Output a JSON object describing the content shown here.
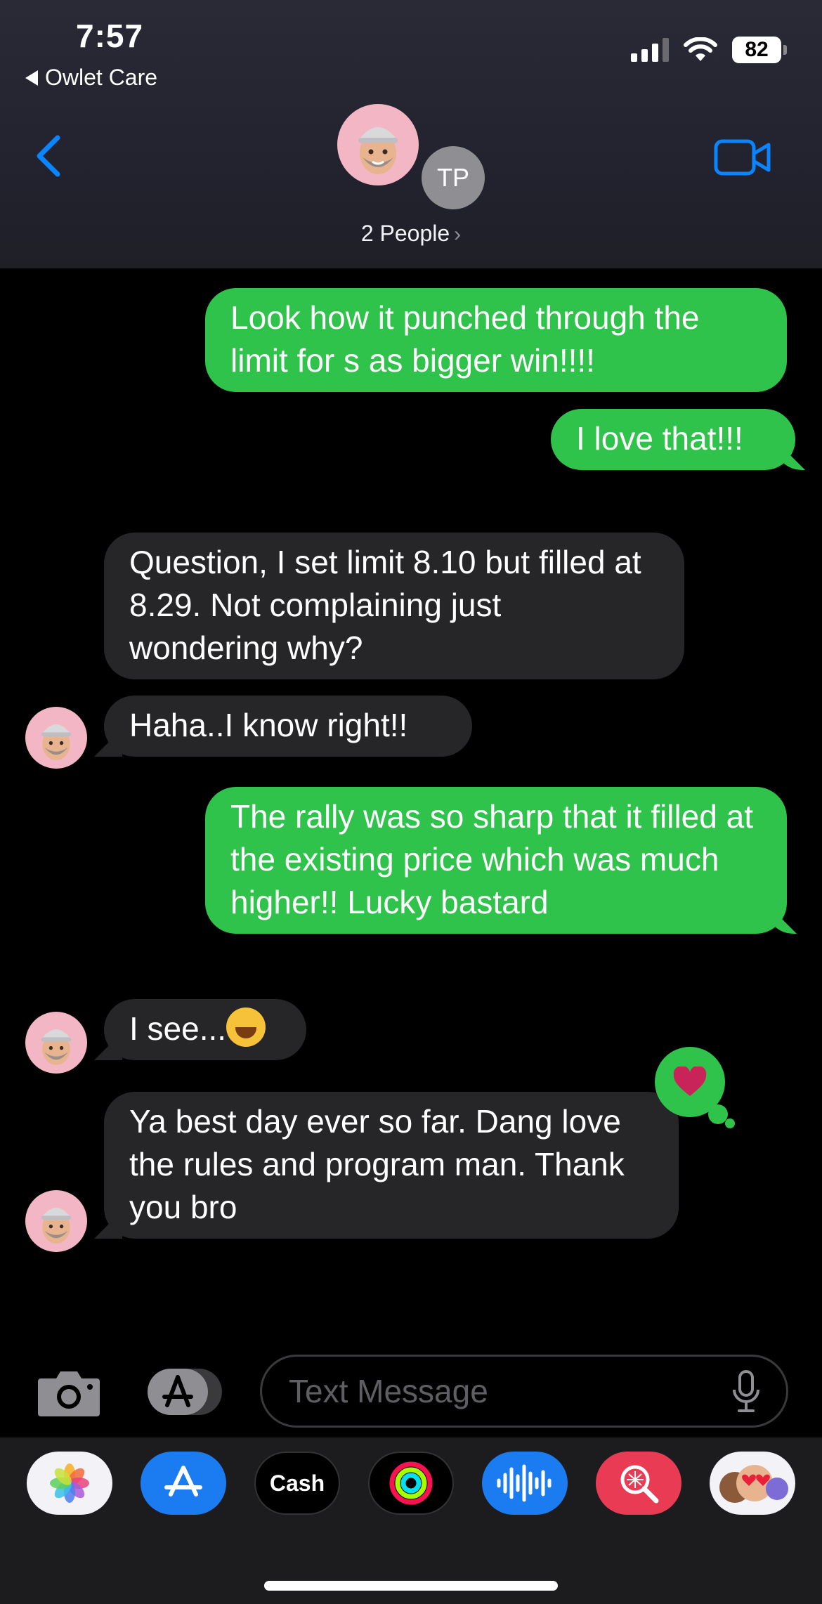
{
  "status": {
    "time": "7:57",
    "back_app": "Owlet Care",
    "battery": "82"
  },
  "conversation": {
    "participants_label": "2 People",
    "initials": "TP"
  },
  "messages": [
    {
      "type": "sent",
      "text": "Look how it punched through the limit for s as bigger win!!!!"
    },
    {
      "type": "sent",
      "text": "I love that!!!"
    },
    {
      "type": "received",
      "text": "Question, I set limit 8.10 but filled at 8.29. Not complaining just wondering why?"
    },
    {
      "type": "received",
      "text": "Haha..I know right!!"
    },
    {
      "type": "sent",
      "text": "The rally was so sharp that it filled at the existing price which was much higher!! Lucky bastard"
    },
    {
      "type": "received",
      "text": "I see...",
      "emoji": "face-with-tears-of-joy"
    },
    {
      "type": "received",
      "text": "Ya best day ever so far. Dang love the rules and program man. Thank you bro",
      "reaction": "heart"
    }
  ],
  "composer": {
    "placeholder": "Text Message"
  },
  "dock": {
    "apps": [
      {
        "name": "photos-icon"
      },
      {
        "name": "app-store-icon"
      },
      {
        "name": "apple-cash-icon",
        "label": "Cash"
      },
      {
        "name": "activity-icon"
      },
      {
        "name": "audio-message-icon"
      },
      {
        "name": "image-search-icon"
      },
      {
        "name": "memoji-icon"
      }
    ]
  },
  "colors": {
    "sent_bubble": "#30c34b",
    "received_bubble": "#262629",
    "accent": "#0a84ff"
  }
}
